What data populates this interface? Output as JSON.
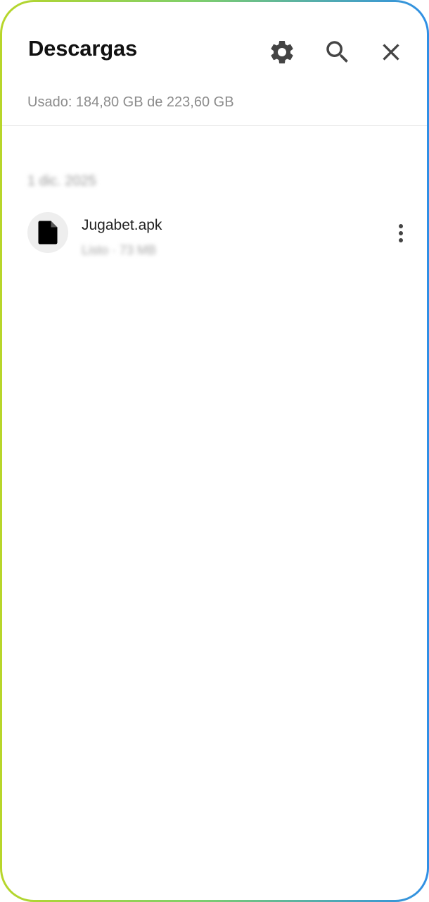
{
  "header": {
    "title": "Descargas",
    "storage_text": "Usado: 184,80 GB de 223,60 GB",
    "icons": [
      "gear-icon",
      "search-icon",
      "close-icon"
    ]
  },
  "list": {
    "groups": [
      {
        "date_label": "1 dic. 2025",
        "items": [
          {
            "name": "Jugabet.apk",
            "meta": "Listo · 73 MB"
          }
        ]
      }
    ]
  },
  "colors": {
    "frame_gradient_start": "#b8d62a",
    "frame_gradient_end": "#2f8fe6",
    "title": "#111111",
    "secondary_text": "#8c8c8c",
    "icon": "#444444"
  }
}
